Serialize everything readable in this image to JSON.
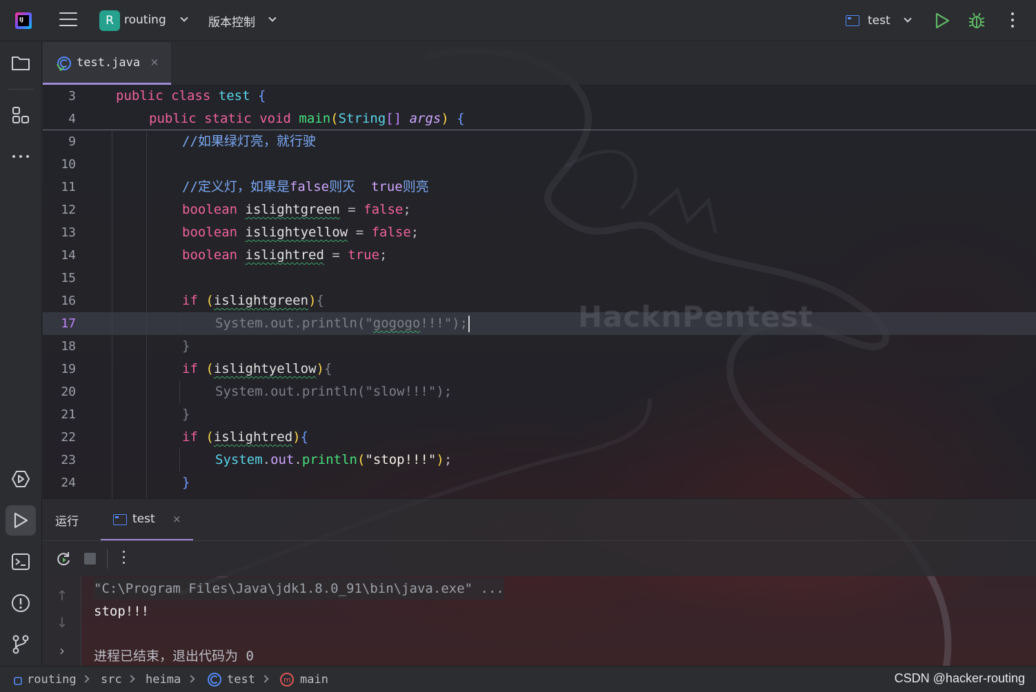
{
  "titlebar": {
    "project_badge": "R",
    "project_name": "routing",
    "vcs_label": "版本控制",
    "run_config": "test"
  },
  "tabs": [
    {
      "label": "test.java",
      "close": "×"
    }
  ],
  "editor": {
    "lines": [
      {
        "no": "3"
      },
      {
        "no": "4"
      },
      {
        "no": "9",
        "comment": "//如果绿灯亮，就行驶"
      },
      {
        "no": "10"
      },
      {
        "no": "11",
        "comment_a": "//定义灯，如果是",
        "comment_kw1": "false",
        "comment_b": "则灭  ",
        "comment_kw2": "true",
        "comment_c": "则亮"
      },
      {
        "no": "12",
        "type": "boolean",
        "var": "islightgreen",
        "op": " = ",
        "val": "false",
        "end": ";"
      },
      {
        "no": "13",
        "type": "boolean",
        "var": "islightyellow",
        "op": " = ",
        "val": "false",
        "end": ";"
      },
      {
        "no": "14",
        "type": "boolean",
        "var": "islightred",
        "op": " = ",
        "val": "true",
        "end": ";"
      },
      {
        "no": "15"
      },
      {
        "no": "16",
        "kw": "if",
        "cond": "islightgreen"
      },
      {
        "no": "17",
        "text_a": "System.out.println(\"",
        "text_b": "gogogo",
        "text_c": "!!!\");"
      },
      {
        "no": "18",
        "text": "}"
      },
      {
        "no": "19",
        "kw": "if",
        "cond": "islightyellow"
      },
      {
        "no": "20",
        "text": "System.out.println(\"slow!!!\");"
      },
      {
        "no": "21",
        "text": "}"
      },
      {
        "no": "22",
        "kw": "if",
        "cond": "islightred"
      },
      {
        "no": "23",
        "obj": "System",
        "field": "out",
        "method": "println",
        "arg": "\"stop!!!\""
      },
      {
        "no": "24",
        "text": "}"
      }
    ],
    "header_line3": {
      "kw1": "public",
      "kw2": "class",
      "name": "test",
      "brace": "{"
    },
    "header_line4": {
      "kw1": "public",
      "kw2": "static",
      "kw3": "void",
      "fn": "main",
      "type": "String",
      "param": "args"
    },
    "watermark": "HacknPentest"
  },
  "run_panel": {
    "title": "运行",
    "tab_label": "test",
    "tab_close": "×",
    "console": [
      "\"C:\\Program Files\\Java\\jdk1.8.0_91\\bin\\java.exe\" ...",
      "stop!!!",
      "",
      "进程已结束，退出代码为 0"
    ]
  },
  "statusbar": {
    "breadcrumbs": [
      "routing",
      "src",
      "heima",
      "test",
      "main"
    ],
    "credit": "CSDN @hacker-routing"
  },
  "colors": {
    "accent_tab": "#a08bd7",
    "keyword": "#f0629b",
    "comment": "#7aa8f2",
    "function": "#47e07d",
    "class": "#59d4e8",
    "run_green": "#5fb865"
  }
}
